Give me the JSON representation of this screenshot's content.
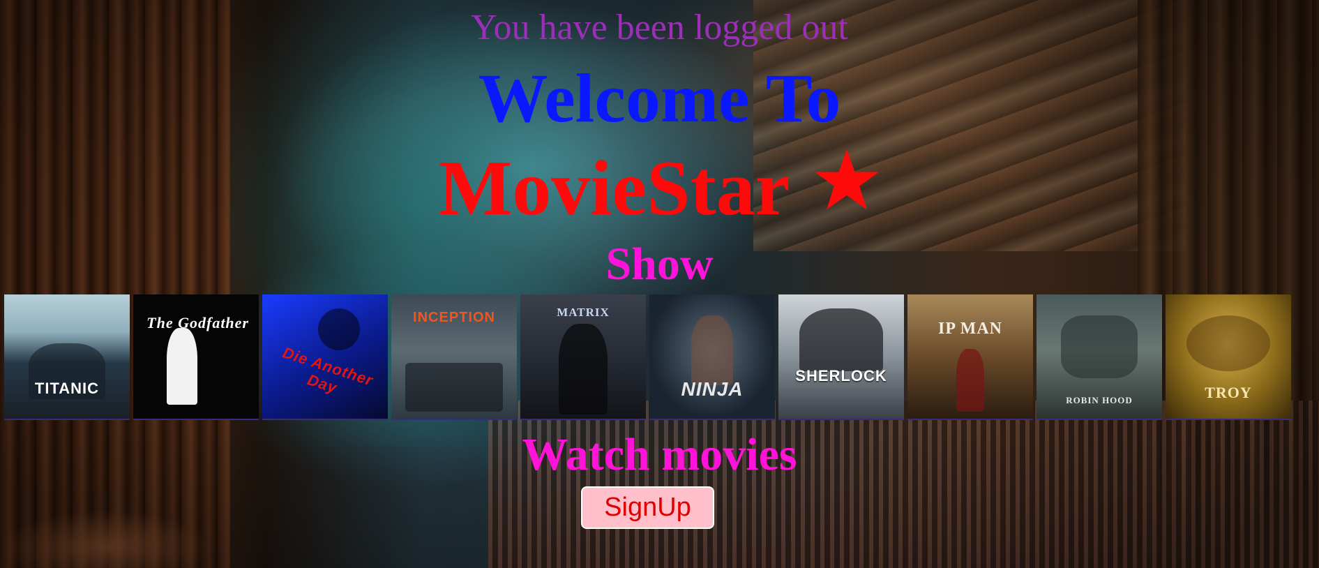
{
  "header": {
    "logout_message": "You have been logged out",
    "welcome": "Welcome To",
    "brand": "MovieStar",
    "brand_icon": "star-icon",
    "show": "Show"
  },
  "posters": [
    {
      "id": "titanic",
      "title": "TITANIC"
    },
    {
      "id": "godfather",
      "title": "The Godfather"
    },
    {
      "id": "dad",
      "title": "Die Another Day"
    },
    {
      "id": "inception",
      "title": "INCEPTION"
    },
    {
      "id": "matrix",
      "title": "MATRIX"
    },
    {
      "id": "ninja",
      "title": "NINJA"
    },
    {
      "id": "sherlock",
      "title": "SHERLOCK"
    },
    {
      "id": "ipman",
      "title": "IP MAN"
    },
    {
      "id": "robinhood",
      "title": "ROBIN HOOD"
    },
    {
      "id": "troy",
      "title": "TROY"
    }
  ],
  "cta": {
    "watch": "Watch movies",
    "signup_label": "SignUp"
  },
  "colors": {
    "logout_message": "#9b2fb7",
    "welcome": "#0a18ff",
    "brand": "#ff0a0a",
    "show": "#ff13d8",
    "signup_bg": "#ffc0cb",
    "signup_text": "#e00000"
  }
}
